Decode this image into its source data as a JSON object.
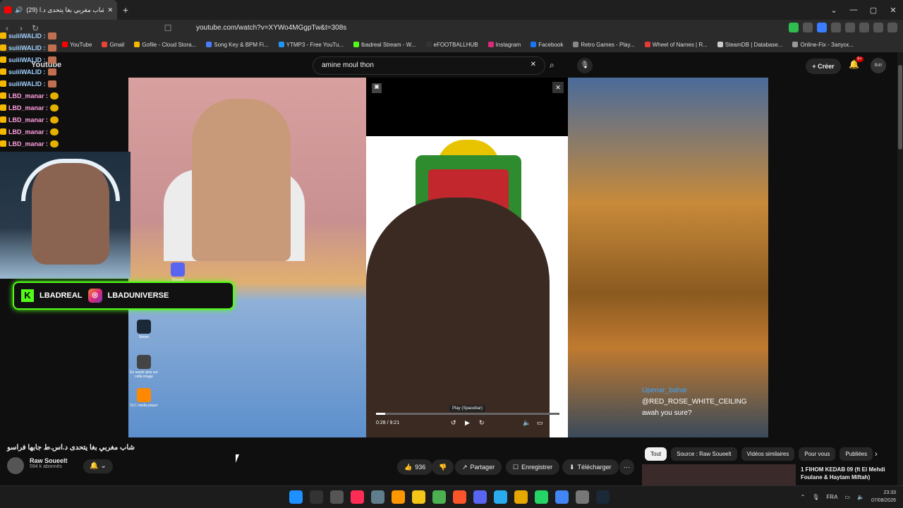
{
  "browser": {
    "tab_title": "(29) شاب مغربي بغا يتحدى د.ا...",
    "new_tab": "+",
    "url": "youtube.com/watch?v=XYWo4MGgpTw&t=308s",
    "window_controls": [
      "⌄",
      "—",
      "▢",
      "✕"
    ]
  },
  "bookmarks": [
    {
      "label": "YouTube",
      "color": "#ff0000"
    },
    {
      "label": "Gmail",
      "color": "#ea4335"
    },
    {
      "label": "Gofile - Cloud Stora...",
      "color": "#f5b800"
    },
    {
      "label": "Song Key & BPM Fi...",
      "color": "#4a7cff"
    },
    {
      "label": "YTMP3 - Free YouTu...",
      "color": "#2196f3"
    },
    {
      "label": "lbadreal Stream - W...",
      "color": "#53fc18"
    },
    {
      "label": "eFOOTBALLHUB",
      "color": "#333333"
    },
    {
      "label": "Instagram",
      "color": "#dd2a7b"
    },
    {
      "label": "Facebook",
      "color": "#1877f2"
    },
    {
      "label": "Retro Games - Play...",
      "color": "#888888"
    },
    {
      "label": "Wheel of Names | R...",
      "color": "#e53935"
    },
    {
      "label": "SteamDB | Database...",
      "color": "#cccccc"
    },
    {
      "label": "Online-Fix - Запуск...",
      "color": "#999999"
    }
  ],
  "youtube": {
    "logo": "Youtube",
    "search_value": "amine moul thon",
    "create_label": "+ Créer",
    "notif_count": "9+",
    "avatar_text": "Bdrl"
  },
  "overlay": {
    "chat": [
      {
        "user": "suiiiWALID :",
        "type": "walid"
      },
      {
        "user": "suiiiWALID :",
        "type": "walid"
      },
      {
        "user": "suiiiWALID :",
        "type": "walid"
      },
      {
        "user": "suiiiWALID :",
        "type": "walid"
      },
      {
        "user": "suiiiWALID :",
        "type": "walid"
      },
      {
        "user": "LBD_manar :",
        "type": "manar"
      },
      {
        "user": "LBD_manar :",
        "type": "manar"
      },
      {
        "user": "LBD_manar :",
        "type": "manar"
      },
      {
        "user": "LBD_manar :",
        "type": "manar"
      },
      {
        "user": "LBD_manar :",
        "type": "manar"
      }
    ],
    "kick_name": "LBADREAL",
    "ig_name": "LBADUNIVERSE",
    "desktop_icons": [
      {
        "label": "Discord",
        "color": "#5865f2"
      },
      {
        "label": "Steam",
        "color": "#1b2838"
      },
      {
        "label": "En savoir plus sur cette image",
        "color": "#444444"
      },
      {
        "label": "VLC media player",
        "color": "#ff8800"
      }
    ]
  },
  "player": {
    "caption_user": "@RED_ROSE_WHITE_CEILING",
    "caption_user_hidden": "Upenar_bahar",
    "caption_text": "awah you sure?",
    "time": "0:28 / 9:21",
    "tooltip": "Play (Spacebar)",
    "progress": 0.05
  },
  "video": {
    "title": "شاب مغربي بغا يتحدى د.اس.ط جابها فراسو",
    "channel": "Raw Soueelt",
    "subscribers": "594 k abonnés",
    "likes": "936",
    "share": "Partager",
    "save": "Enregistrer",
    "download": "Télécharger",
    "more": "⋯"
  },
  "chips": [
    "Tout",
    "Source : Raw Soueelt",
    "Vidéos similaires",
    "Pour vous",
    "Publiées"
  ],
  "recommended": {
    "title": "1 FIHOM KEDAB 09 (ft El Mehdi Foulane & Haytam Miftah)"
  },
  "taskbar": {
    "lang": "FRA",
    "time": "23:33",
    "date": "07/08/2026"
  }
}
